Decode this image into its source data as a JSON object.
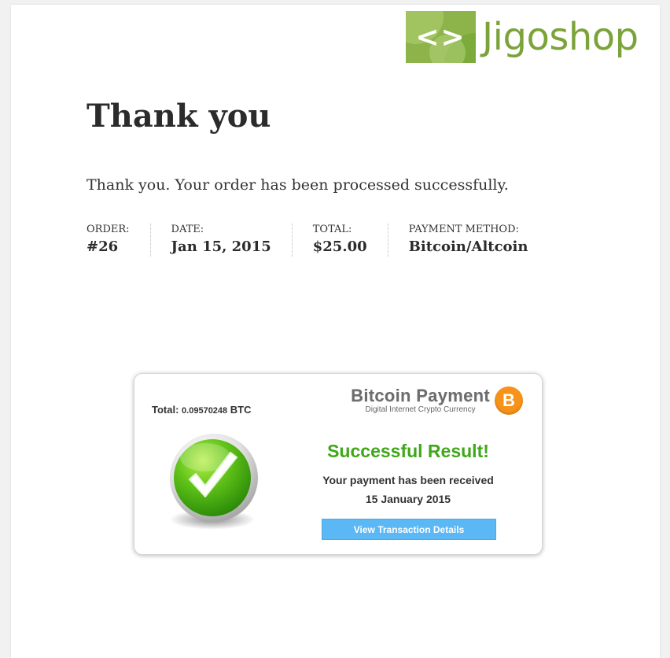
{
  "logo": {
    "mark_glyph": "<>",
    "text": "Jigoshop"
  },
  "page": {
    "title": "Thank you",
    "message": "Thank you. Your order has been processed successfully."
  },
  "order_details": {
    "order": {
      "label": "ORDER:",
      "value": "#26"
    },
    "date": {
      "label": "DATE:",
      "value": "Jan 15, 2015"
    },
    "total": {
      "label": "TOTAL:",
      "value": "$25.00"
    },
    "payment_method": {
      "label": "PAYMENT METHOD:",
      "value": "Bitcoin/Altcoin"
    }
  },
  "bitcoin_card": {
    "total_label": "Total:",
    "total_amount": "0.09570248",
    "total_currency": "BTC",
    "brand_title": "Bitcoin Payment",
    "brand_subtitle": "Digital Internet Crypto Currency",
    "coin_icon": "bitcoin-icon",
    "coin_symbol": "B",
    "check_icon": "checkmark-icon",
    "result_title": "Successful Result!",
    "result_message": "Your payment has been received",
    "result_date": "15 January 2015",
    "view_button": "View Transaction Details"
  },
  "colors": {
    "logo_green": "#7ba33a",
    "success_green": "#3fa718",
    "button_blue": "#5bb8f5",
    "bitcoin_orange": "#f7931a"
  }
}
